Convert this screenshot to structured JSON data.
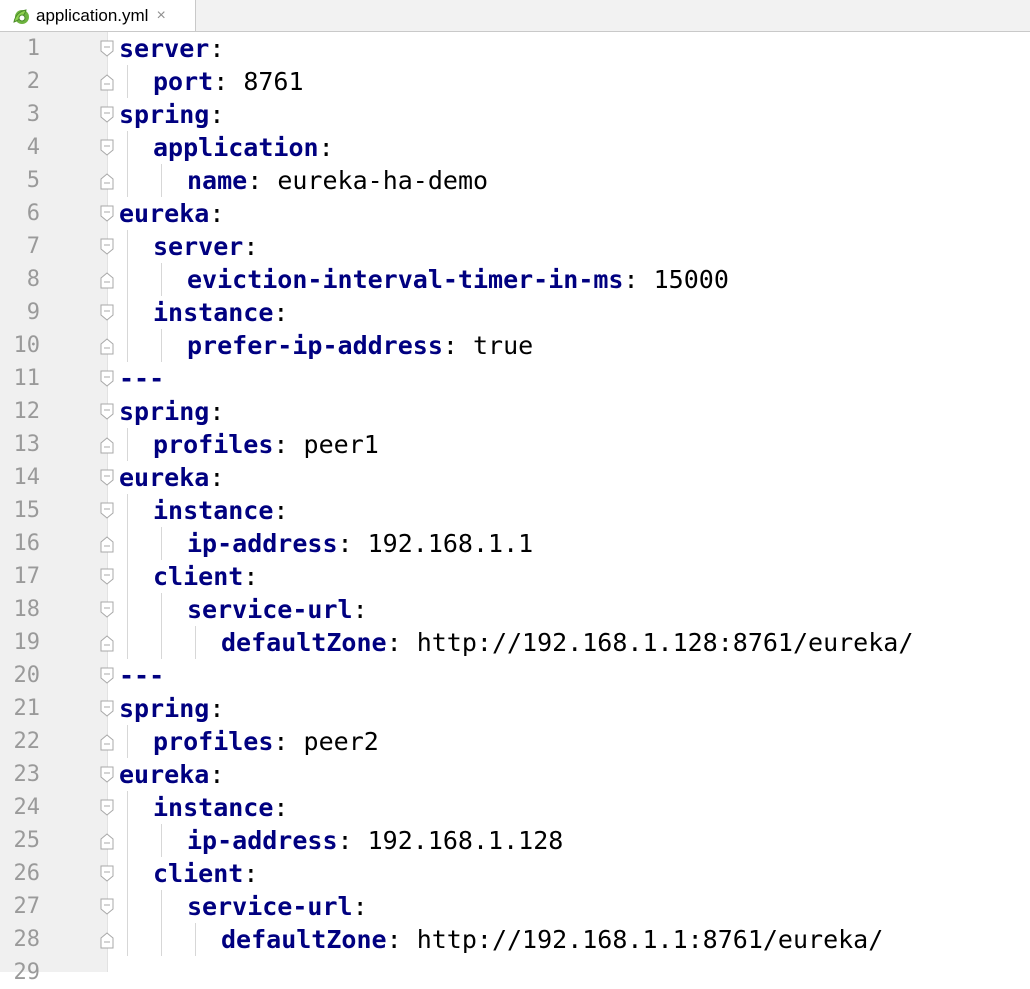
{
  "tab": {
    "title": "application.yml",
    "icon": "spring-leaf-icon",
    "close": "×"
  },
  "lines": [
    {
      "n": "1",
      "indent": 0,
      "key": "server",
      "colon": ":",
      "value": "",
      "fold": "start"
    },
    {
      "n": "2",
      "indent": 1,
      "key": "port",
      "colon": ":",
      "value": " 8761",
      "fold": "end"
    },
    {
      "n": "3",
      "indent": 0,
      "key": "spring",
      "colon": ":",
      "value": "",
      "fold": "start"
    },
    {
      "n": "4",
      "indent": 1,
      "key": "application",
      "colon": ":",
      "value": "",
      "fold": "start"
    },
    {
      "n": "5",
      "indent": 2,
      "key": "name",
      "colon": ":",
      "value": " eureka-ha-demo",
      "fold": "end"
    },
    {
      "n": "6",
      "indent": 0,
      "key": "eureka",
      "colon": ":",
      "value": "",
      "fold": "start"
    },
    {
      "n": "7",
      "indent": 1,
      "key": "server",
      "colon": ":",
      "value": "",
      "fold": "start"
    },
    {
      "n": "8",
      "indent": 2,
      "key": "eviction-interval-timer-in-ms",
      "colon": ":",
      "value": " 15000",
      "fold": "end"
    },
    {
      "n": "9",
      "indent": 1,
      "key": "instance",
      "colon": ":",
      "value": "",
      "fold": "start"
    },
    {
      "n": "10",
      "indent": 2,
      "key": "prefer-ip-address",
      "colon": ":",
      "value": " true",
      "fold": "end"
    },
    {
      "n": "11",
      "indent": 0,
      "key": "---",
      "colon": "",
      "value": "",
      "fold": "start"
    },
    {
      "n": "12",
      "indent": 0,
      "key": "spring",
      "colon": ":",
      "value": "",
      "fold": "start"
    },
    {
      "n": "13",
      "indent": 1,
      "key": "profiles",
      "colon": ":",
      "value": " peer1",
      "fold": "end"
    },
    {
      "n": "14",
      "indent": 0,
      "key": "eureka",
      "colon": ":",
      "value": "",
      "fold": "start"
    },
    {
      "n": "15",
      "indent": 1,
      "key": "instance",
      "colon": ":",
      "value": "",
      "fold": "start"
    },
    {
      "n": "16",
      "indent": 2,
      "key": "ip-address",
      "colon": ":",
      "value": " 192.168.1.1",
      "fold": "end"
    },
    {
      "n": "17",
      "indent": 1,
      "key": "client",
      "colon": ":",
      "value": "",
      "fold": "start"
    },
    {
      "n": "18",
      "indent": 2,
      "key": "service-url",
      "colon": ":",
      "value": "",
      "fold": "start"
    },
    {
      "n": "19",
      "indent": 3,
      "key": "defaultZone",
      "colon": ":",
      "value": " http://192.168.1.128:8761/eureka/",
      "fold": "end"
    },
    {
      "n": "20",
      "indent": 0,
      "key": "---",
      "colon": "",
      "value": "",
      "fold": "start"
    },
    {
      "n": "21",
      "indent": 0,
      "key": "spring",
      "colon": ":",
      "value": "",
      "fold": "start"
    },
    {
      "n": "22",
      "indent": 1,
      "key": "profiles",
      "colon": ":",
      "value": " peer2",
      "fold": "end"
    },
    {
      "n": "23",
      "indent": 0,
      "key": "eureka",
      "colon": ":",
      "value": "",
      "fold": "start"
    },
    {
      "n": "24",
      "indent": 1,
      "key": "instance",
      "colon": ":",
      "value": "",
      "fold": "start"
    },
    {
      "n": "25",
      "indent": 2,
      "key": "ip-address",
      "colon": ":",
      "value": " 192.168.1.128",
      "fold": "end"
    },
    {
      "n": "26",
      "indent": 1,
      "key": "client",
      "colon": ":",
      "value": "",
      "fold": "start"
    },
    {
      "n": "27",
      "indent": 2,
      "key": "service-url",
      "colon": ":",
      "value": "",
      "fold": "start"
    },
    {
      "n": "28",
      "indent": 3,
      "key": "defaultZone",
      "colon": ":",
      "value": " http://192.168.1.1:8761/eureka/",
      "fold": "end"
    },
    {
      "n": "29",
      "indent": 0,
      "key": "",
      "colon": "",
      "value": "",
      "fold": ""
    }
  ]
}
